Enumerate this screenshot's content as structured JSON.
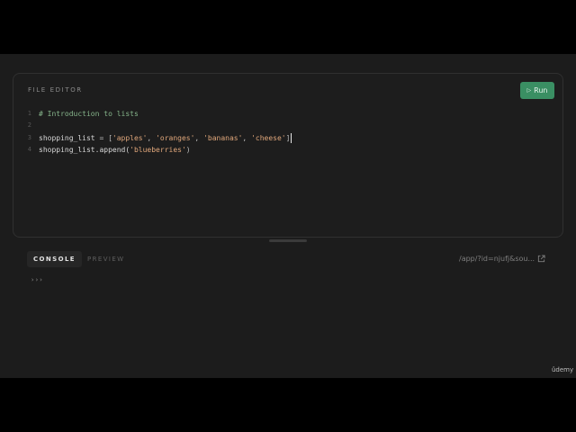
{
  "editor": {
    "title": "FILE EDITOR",
    "run_label": "Run",
    "run_icon": "play-icon",
    "lines": [
      {
        "num": "1",
        "comment": "# Introduction to lists"
      },
      {
        "num": "2"
      },
      {
        "num": "3",
        "ident": "shopping_list",
        "assign": " = [",
        "s1": "'apples'",
        "c1": ", ",
        "s2": "'oranges'",
        "c2": ", ",
        "s3": "'bananas'",
        "c3": ", ",
        "s4": "'cheese'",
        "close": "]"
      },
      {
        "num": "4",
        "ident": "shopping_list",
        "method": ".append(",
        "s1": "'blueberries'",
        "close": ")"
      }
    ]
  },
  "console": {
    "tabs": [
      {
        "label": "CONSOLE",
        "active": true
      },
      {
        "label": "PREVIEW",
        "active": false
      }
    ],
    "url": "/app/?id=njufj&sou...",
    "prompt": "›››"
  },
  "watermark": "ûdemy",
  "colors": {
    "accent": "#3a8f63",
    "string": "#e0a77b",
    "comment": "#86b58b"
  }
}
